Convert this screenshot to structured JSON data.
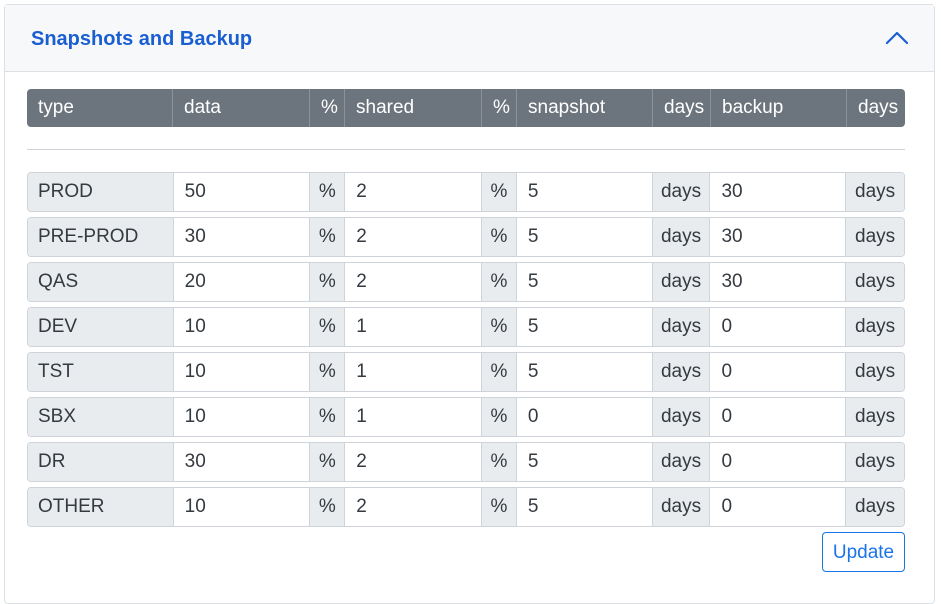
{
  "panel": {
    "title": "Snapshots and Backup",
    "collapse_icon": "chevron-up-icon",
    "accent_color": "#1a5fd1"
  },
  "table": {
    "headers": [
      "type",
      "data",
      "%",
      "shared",
      "%",
      "snapshot",
      "days",
      "backup",
      "days"
    ],
    "header_bg": "#6c757d",
    "unit_percent": "%",
    "unit_days": "days",
    "rows": [
      {
        "type": "PROD",
        "data": "50",
        "shared": "2",
        "snapshot": "5",
        "backup": "30"
      },
      {
        "type": "PRE-PROD",
        "data": "30",
        "shared": "2",
        "snapshot": "5",
        "backup": "30"
      },
      {
        "type": "QAS",
        "data": "20",
        "shared": "2",
        "snapshot": "5",
        "backup": "30"
      },
      {
        "type": "DEV",
        "data": "10",
        "shared": "1",
        "snapshot": "5",
        "backup": "0"
      },
      {
        "type": "TST",
        "data": "10",
        "shared": "1",
        "snapshot": "5",
        "backup": "0"
      },
      {
        "type": "SBX",
        "data": "10",
        "shared": "1",
        "snapshot": "0",
        "backup": "0"
      },
      {
        "type": "DR",
        "data": "30",
        "shared": "2",
        "snapshot": "5",
        "backup": "0"
      },
      {
        "type": "OTHER",
        "data": "10",
        "shared": "2",
        "snapshot": "5",
        "backup": "0"
      }
    ]
  },
  "actions": {
    "update_label": "Update",
    "update_color": "#1a73e8"
  }
}
